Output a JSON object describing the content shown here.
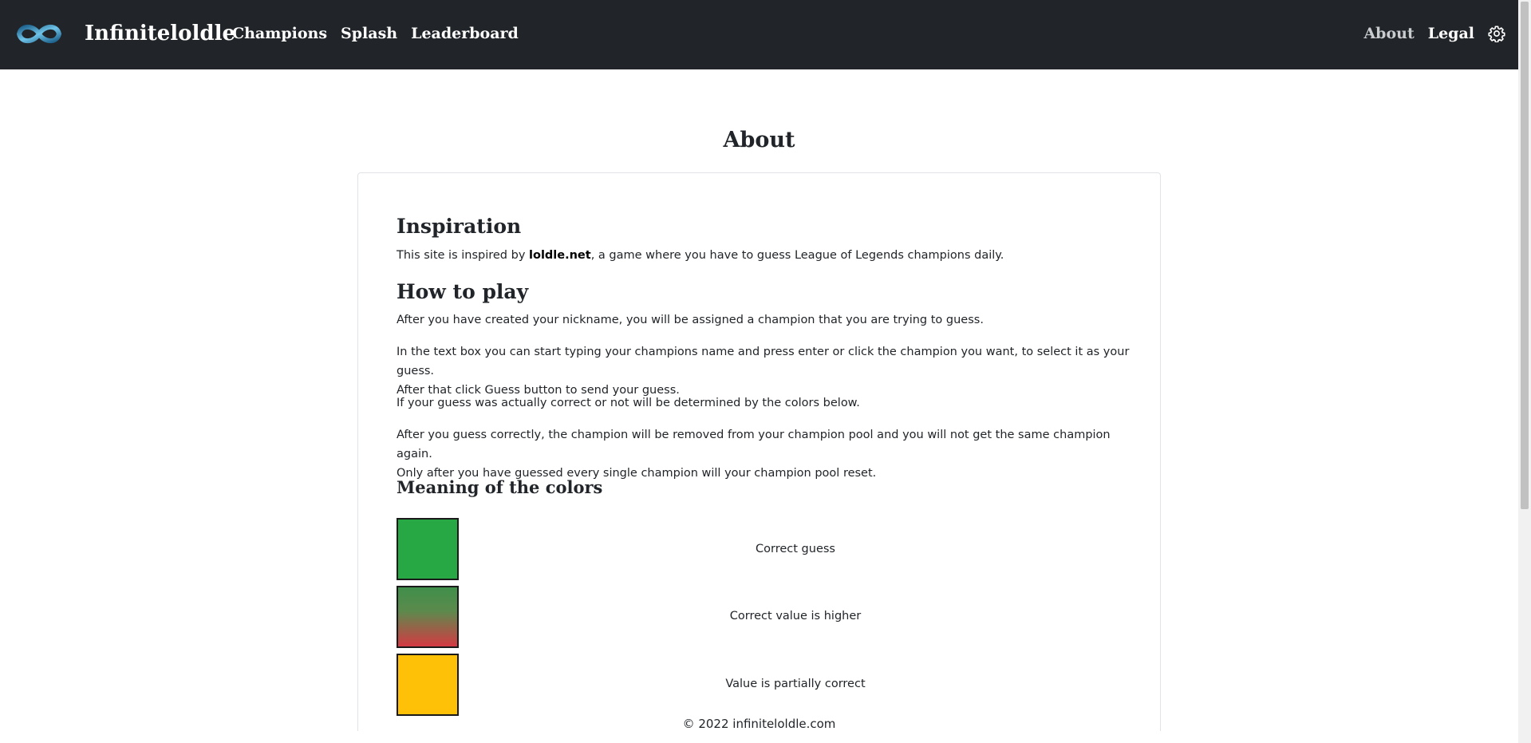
{
  "navbar": {
    "brand": "Infiniteloldle",
    "links": [
      "Champions",
      "Splash",
      "Leaderboard"
    ],
    "right_links": [
      "About",
      "Legal"
    ],
    "settings_icon": "gear-icon",
    "logo_icon": "infinity-logo-icon"
  },
  "page": {
    "title": "About"
  },
  "inspiration": {
    "heading": "Inspiration",
    "text_before": "This site is inspired by ",
    "link": "loldle.net",
    "text_after": ", a game where you have to guess League of Legends champions daily."
  },
  "how_to_play": {
    "heading": "How to play",
    "paragraphs": [
      "After you have created your nickname, you will be assigned a champion that you are trying to guess.",
      "In the text box you can start typing your champions name and press enter or click the champion you want, to select it as your guess.\nAfter that click Guess button to send your guess.",
      "If your guess was actually correct or not will be determined by the colors below.",
      "After you guess correctly, the champion will be removed from your champion pool and you will not get the same champion again.\nOnly after you have guessed every single champion will your champion pool reset."
    ]
  },
  "colors": {
    "heading": "Meaning of the colors",
    "items": [
      {
        "label": "Correct guess",
        "color": "#28a745"
      },
      {
        "label": "Correct value is higher",
        "color_top": "#3f8f4a",
        "color_bottom": "#dc3545"
      },
      {
        "label": "Value is partially correct",
        "color": "#ffc107"
      }
    ]
  },
  "footer": {
    "text": "© 2022 infiniteloldle.com"
  }
}
